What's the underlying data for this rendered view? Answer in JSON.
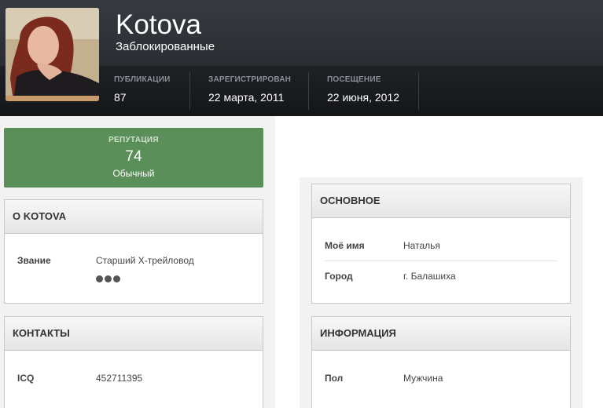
{
  "profile": {
    "name": "Kotova",
    "group": "Заблокированные"
  },
  "stats": [
    {
      "label": "ПУБЛИКАЦИИ",
      "value": "87"
    },
    {
      "label": "ЗАРЕГИСТРИРОВАН",
      "value": "22 марта, 2011"
    },
    {
      "label": "ПОСЕЩЕНИЕ",
      "value": "22 июня, 2012"
    }
  ],
  "reputation": {
    "label": "РЕПУТАЦИЯ",
    "value": "74",
    "text": "Обычный"
  },
  "about": {
    "title": "О KOTOVA",
    "rank_label": "Звание",
    "rank_value": "Старший X-трейловод",
    "rank_pips": 3
  },
  "contacts": {
    "title": "КОНТАКТЫ",
    "icq_label": "ICQ",
    "icq_value": "452711395"
  },
  "basic": {
    "title": "ОСНОВНОЕ",
    "rows": [
      {
        "label": "Моё имя",
        "value": "Наталья"
      },
      {
        "label": "Город",
        "value": "г. Балашиха"
      }
    ]
  },
  "info": {
    "title": "ИНФОРМАЦИЯ",
    "rows": [
      {
        "label": "Пол",
        "value": "Мужчина"
      }
    ]
  },
  "colors": {
    "header_bg": "#2a2e33",
    "reputation_bg": "#5b8f5a",
    "panel_bg": "#f2f2f2"
  }
}
